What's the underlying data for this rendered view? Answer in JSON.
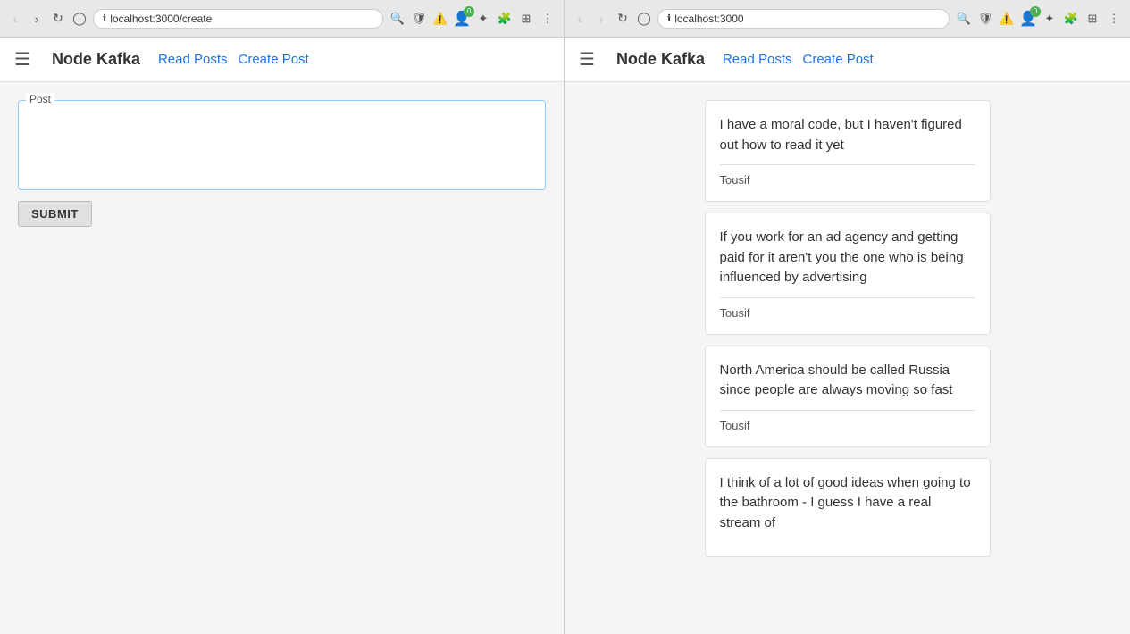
{
  "left_browser": {
    "url": "localhost:3000/create",
    "navbar": {
      "brand": "Node Kafka",
      "links": [
        "Read Posts",
        "Create Post"
      ]
    },
    "form": {
      "legend": "Post",
      "textarea_value": "",
      "textarea_placeholder": "",
      "submit_label": "SUBMIT"
    }
  },
  "right_browser": {
    "url": "localhost:3000",
    "navbar": {
      "brand": "Node Kafka",
      "links": [
        "Read Posts",
        "Create Post"
      ]
    },
    "posts": [
      {
        "text": "I have a moral code, but I haven't figured out how to read it yet",
        "author": "Tousif"
      },
      {
        "text": "If you work for an ad agency and getting paid for it aren't you the one who is being influenced by advertising",
        "author": "Tousif"
      },
      {
        "text": "North America should be called Russia since people are always moving so fast",
        "author": "Tousif"
      },
      {
        "text": "I think of a lot of good ideas when going to the bathroom - I guess I have a real stream of",
        "author": ""
      }
    ]
  },
  "icons": {
    "back": "‹",
    "forward": "›",
    "reload": "↻",
    "bookmark": "⊕",
    "lock": "🔒",
    "search": "🔍",
    "menu": "⋮",
    "hamburger": "≡",
    "shield": "🛡",
    "alert": "⚠",
    "profile": "👤",
    "puzzle": "🧩",
    "extension": "⊞"
  }
}
